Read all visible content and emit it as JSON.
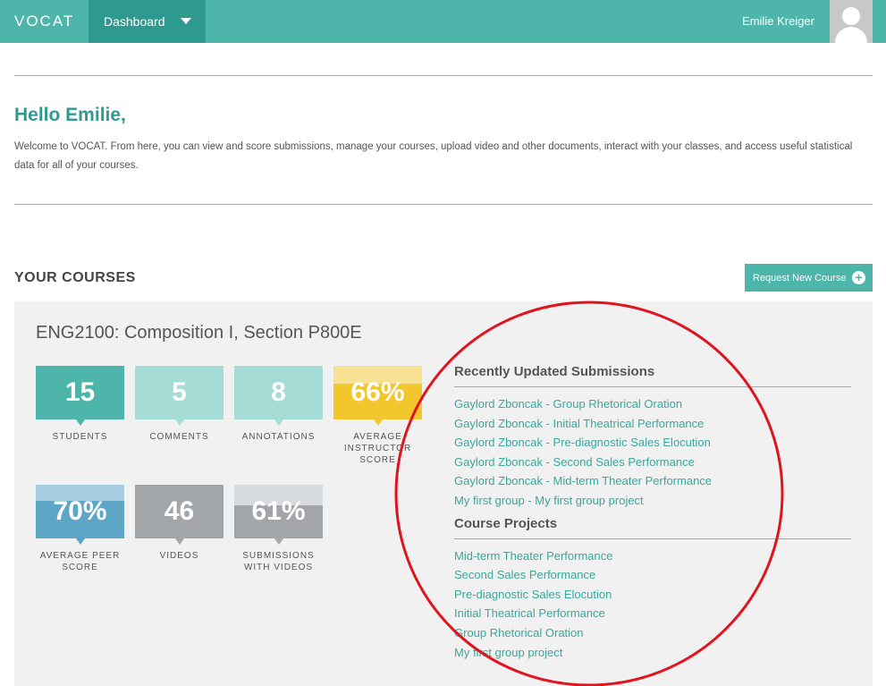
{
  "app": {
    "logo": "VOCAT"
  },
  "nav": {
    "dashboard_label": "Dashboard",
    "user_name": "Emilie Kreiger"
  },
  "greeting": {
    "title": "Hello Emilie,",
    "text": "Welcome to VOCAT. From here, you can view and score submissions, manage your courses, upload video and other documents, interact with your classes, and access useful statistical data for all of your courses."
  },
  "courses": {
    "heading": "YOUR COURSES",
    "request_button": "Request New Course",
    "course": {
      "title": "ENG2100: Composition I, Section P800E",
      "stats": [
        {
          "value": "15",
          "label": "STUDENTS",
          "color": "#4db5aa",
          "light": "#4db5aa",
          "fill": 1.0
        },
        {
          "value": "5",
          "label": "COMMENTS",
          "color": "#a6dcd6",
          "light": "#a6dcd6",
          "fill": 1.0
        },
        {
          "value": "8",
          "label": "ANNOTATIONS",
          "color": "#a6dcd6",
          "light": "#a6dcd6",
          "fill": 1.0
        },
        {
          "value": "66%",
          "label": "AVERAGE INSTRUCTOR SCORE",
          "color": "#f2c62d",
          "light": "#f7e193",
          "fill": 0.66
        },
        {
          "value": "70%",
          "label": "AVERAGE PEER SCORE",
          "color": "#5ea6c6",
          "light": "#a6cde0",
          "fill": 0.7
        },
        {
          "value": "46",
          "label": "VIDEOS",
          "color": "#a3a6a8",
          "light": "#a3a6a8",
          "fill": 1.0
        },
        {
          "value": "61%",
          "label": "SUBMISSIONS WITH VIDEOS",
          "color": "#a3a6a8",
          "light": "#d8dbdd",
          "fill": 0.61
        }
      ],
      "recent": {
        "heading": "Recently Updated Submissions",
        "items": [
          "Gaylord Zboncak - Group Rhetorical Oration",
          "Gaylord Zboncak - Initial Theatrical Performance",
          "Gaylord Zboncak - Pre-diagnostic Sales Elocution",
          "Gaylord Zboncak - Second Sales Performance",
          "Gaylord Zboncak - Mid-term Theater Performance",
          "My first group - My first group project"
        ]
      },
      "projects": {
        "heading": "Course Projects",
        "items": [
          "Mid-term Theater Performance",
          "Second Sales Performance",
          "Pre-diagnostic Sales Elocution",
          "Initial Theatrical Performance",
          "Group Rhetorical Oration",
          "My first group project"
        ]
      }
    }
  },
  "colors": {
    "brand": "#4db5aa",
    "brand_dark": "#2e9a8f",
    "annotation_ring": "#e0141e"
  }
}
